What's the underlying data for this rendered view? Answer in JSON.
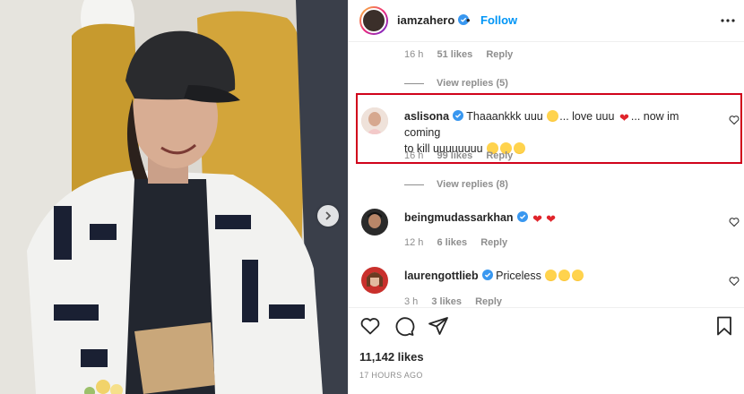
{
  "header": {
    "username": "iamzahero",
    "dot": "•",
    "follow_label": "Follow",
    "more_icon": "more-horizontal-icon"
  },
  "comments_top_meta": {
    "time": "16 h",
    "likes": "51 likes",
    "reply": "Reply"
  },
  "view_replies_1": "View replies (5)",
  "highlighted_comment": {
    "username": "aslisona",
    "text_part1": "Thaaankkk uuu",
    "text_part2": "... love uuu",
    "text_part3": "... now im coming",
    "text_part4": "to kill uuuuuuuu",
    "time": "16 h",
    "likes": "99 likes",
    "reply": "Reply",
    "highlight_color": "#d0021b"
  },
  "view_replies_2": "View replies (8)",
  "comment_2": {
    "username": "beingmudassarkhan",
    "time": "12 h",
    "likes": "6 likes",
    "reply": "Reply"
  },
  "comment_3": {
    "username": "laurengottlieb",
    "text": "Priceless",
    "time": "3 h",
    "likes": "3 likes",
    "reply": "Reply"
  },
  "footer": {
    "likes": "11,142 likes",
    "time_ago": "17 HOURS AGO"
  },
  "colors": {
    "accent": "#0095f6",
    "verified": "#3897f0",
    "muted": "#8e8e8e"
  }
}
